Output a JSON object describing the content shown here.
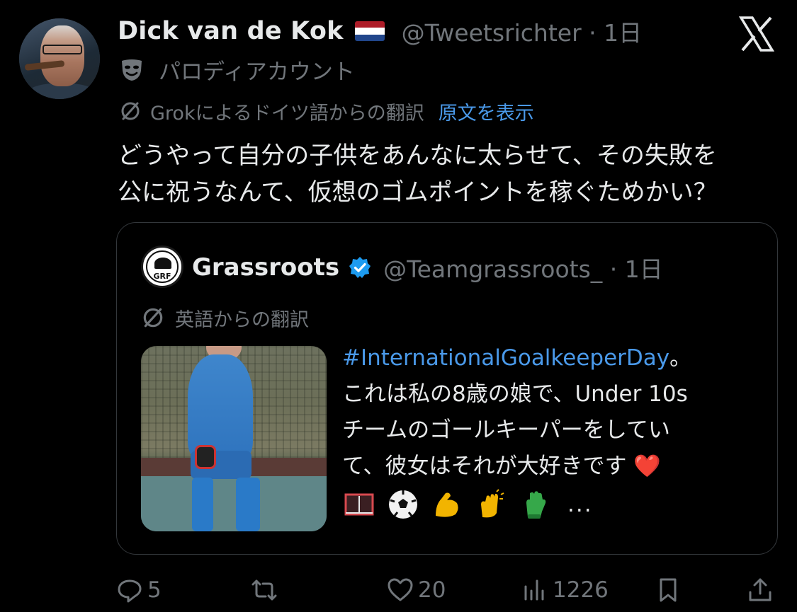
{
  "tweet": {
    "display_name": "Dick van de Kok",
    "flag": "netherlands-flag",
    "handle_time": "@Tweetsrichter · 1日",
    "parody_label": "パロディアカウント",
    "translation_note": "Grokによるドイツ語からの翻訳",
    "show_original": "原文を表示",
    "body": "どうやって自分の子供をあんなに太らせて、その失敗を\n公に祝うなんて、仮想のゴムポイントを稼ぐためかい？"
  },
  "quote": {
    "avatar_text": "GRF",
    "name": "Grassroots",
    "handle_time": "@Teamgrassroots_ · 1日",
    "translation_note": "英語からの翻訳",
    "hashtag": "#InternationalGoalkeeperDay",
    "text_after_hashtag": "。\nこれは私の8歳の娘で、Under 10s\nチームのゴールキーパーをしてい\nて、彼女はそれが大好きです ❤️",
    "emojis": [
      "goal-net-emoji",
      "soccer-ball-emoji",
      "flexed-biceps-emoji",
      "clapping-hands-emoji",
      "glove-emoji"
    ],
    "ellipsis": "..."
  },
  "actions": {
    "replies": "5",
    "reposts": "",
    "likes": "20",
    "views": "1226"
  },
  "colors": {
    "background": "#000000",
    "text": "#e7e9ea",
    "muted": "#71767b",
    "link": "#4a99e9",
    "border": "#33373b",
    "verified": "#1d9bf0"
  }
}
